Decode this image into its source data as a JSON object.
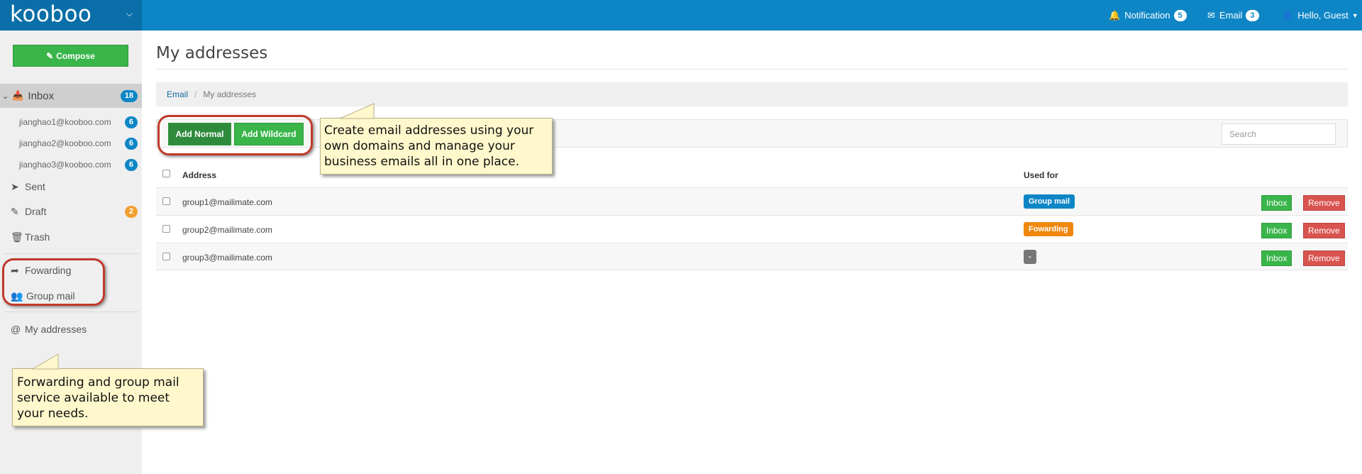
{
  "header": {
    "logo": "kooboo",
    "notification_label": "Notification",
    "notification_count": "5",
    "email_label": "Email",
    "email_count": "3",
    "user_label": "Hello, Guest"
  },
  "sidebar": {
    "compose_label": "Compose",
    "inbox_label": "Inbox",
    "inbox_count": "18",
    "accounts": [
      {
        "address": "jianghao1@kooboo.com",
        "count": "6"
      },
      {
        "address": "jianghao2@kooboo.com",
        "count": "6"
      },
      {
        "address": "jianghao3@kooboo.com",
        "count": "6"
      }
    ],
    "sent_label": "Sent",
    "draft_label": "Draft",
    "draft_count": "2",
    "trash_label": "Trash",
    "forwarding_label": "Fowarding",
    "groupmail_label": "Group mail",
    "addresses_label": "My addresses"
  },
  "callouts": {
    "sidebar_tip": "Forwarding and group mail service available to meet your needs.",
    "toolbar_tip": "Create email addresses using your own domains and manage your business emails all in one place."
  },
  "main": {
    "title": "My addresses",
    "breadcrumb": {
      "root": "Email",
      "current": "My addresses"
    },
    "add_normal_label": "Add Normal",
    "add_wildcard_label": "Add Wildcard",
    "search_placeholder": "Search",
    "columns": {
      "address": "Address",
      "used_for": "Used for"
    },
    "rows": [
      {
        "address": "group1@mailimate.com",
        "used_for": "Group mail",
        "used_color": "#0e86c6",
        "inbox": "Inbox",
        "remove": "Remove"
      },
      {
        "address": "group2@mailimate.com",
        "used_for": "Fowarding",
        "used_color": "#f0870f",
        "inbox": "Inbox",
        "remove": "Remove"
      },
      {
        "address": "group3@mailimate.com",
        "used_for": "-",
        "used_color": "#777777",
        "inbox": "Inbox",
        "remove": "Remove"
      }
    ]
  },
  "colors": {
    "brand": "#0e86c6",
    "success": "#39b54a",
    "danger": "#d9534f",
    "warning": "#f0a030"
  }
}
